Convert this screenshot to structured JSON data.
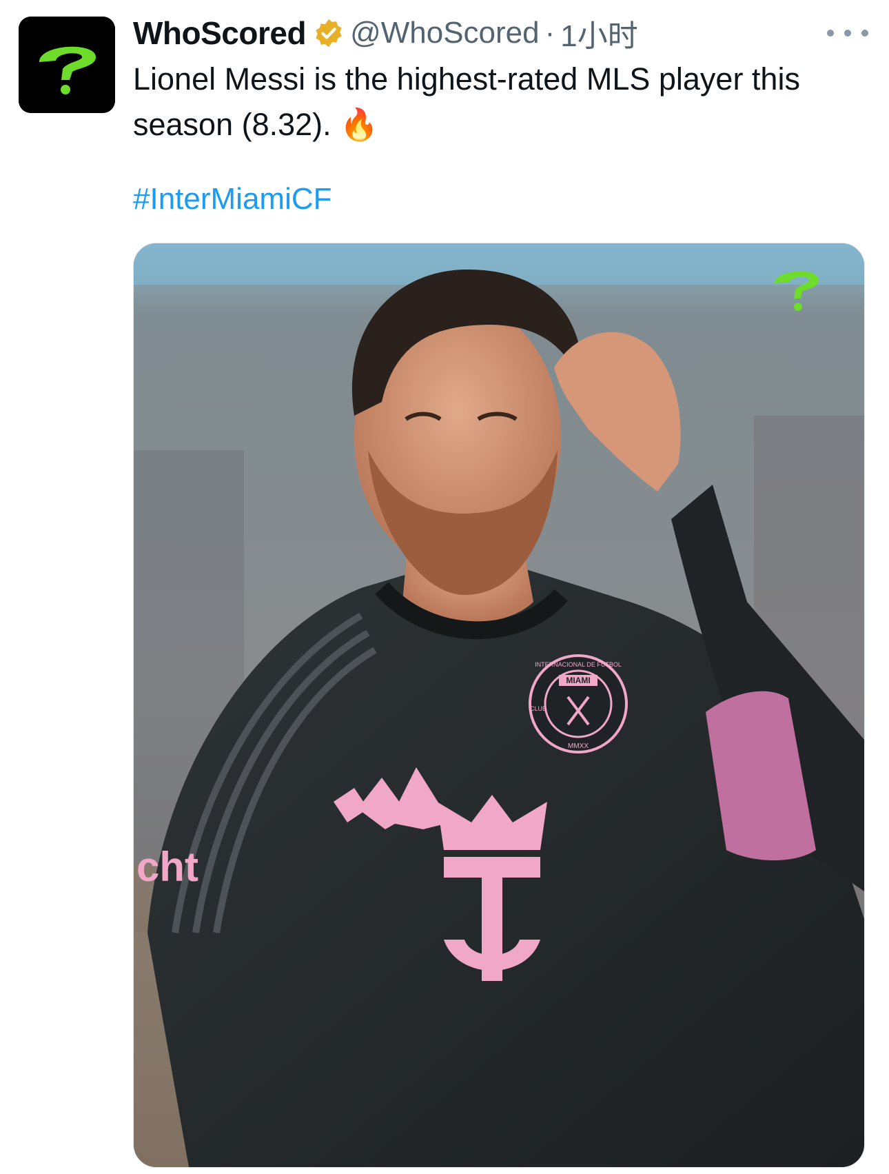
{
  "tweet": {
    "author_name": "WhoScored",
    "handle": "@WhoScored",
    "separator": "·",
    "time": "1小时",
    "avatar_icon": "whoscored-logo-icon",
    "verified_icon": "gold-verified-badge-icon",
    "more_icon": "more-options-icon",
    "text_line1": "Lionel Messi is the highest-rated MLS player this",
    "text_line2": "season (8.32).",
    "emoji": "🔥",
    "hashtag": "#InterMiamiCF",
    "colors": {
      "accent_green": "#6ddc2b",
      "link_blue": "#1d9bf0",
      "jersey_pink": "#f1a7c8",
      "badge_gold": "#e8b027"
    }
  },
  "media": {
    "description_icon": "player-photo-image",
    "crest_text_top": "INTERNACIONAL DE FUTBOL",
    "crest_text_name": "MIAMI",
    "crest_text_bottom": "MMXX",
    "crest_text_side": "CLUB",
    "sleeve_sponsor": "cht",
    "watermark_icon": "whoscored-logo-icon"
  }
}
